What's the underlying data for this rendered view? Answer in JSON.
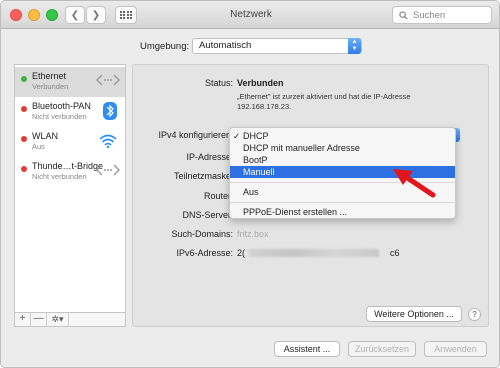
{
  "window": {
    "title": "Netzwerk"
  },
  "toolbar": {
    "search_placeholder": "Suchen"
  },
  "location": {
    "label": "Umgebung:",
    "value": "Automatisch"
  },
  "services": [
    {
      "name": "Ethernet",
      "status": "Verbunden",
      "color": "#3cb43c",
      "icon": "ethernet-icon"
    },
    {
      "name": "Bluetooth-PAN",
      "status": "Nicht verbunden",
      "color": "#e03b35",
      "icon": "bluetooth-icon"
    },
    {
      "name": "WLAN",
      "status": "Aus",
      "color": "#e03b35",
      "icon": "wifi-icon"
    },
    {
      "name": "Thunde…t-Bridge",
      "status": "Nicht verbunden",
      "color": "#e03b35",
      "icon": "ethernet-icon"
    }
  ],
  "sidebar_footer": {
    "add": "+",
    "remove": "—",
    "gear": "✲▾"
  },
  "detail": {
    "status_label": "Status:",
    "status_value": "Verbunden",
    "status_desc_1": "„Ethernet\" ist zurzeit aktiviert und hat die IP-Adresse",
    "status_desc_2": "192.168.178.23.",
    "ipv4_label": "IPv4 konfigurieren",
    "ip_label": "IP-Adresse",
    "subnet_label": "Teilnetzmaske",
    "router_label": "Router",
    "dns_label": "DNS-Server",
    "search_domains_label": "Such-Domains:",
    "search_domains_value": "fritz.box",
    "ipv6_label": "IPv6-Adresse:",
    "ipv6_prefix": "2(",
    "ipv6_suffix": "c6"
  },
  "dropdown": {
    "items": [
      {
        "label": "DHCP",
        "checked": "✓"
      },
      {
        "label": "DHCP mit manueller Adresse",
        "checked": ""
      },
      {
        "label": "BootP",
        "checked": ""
      },
      {
        "label": "Manuell",
        "checked": ""
      }
    ],
    "after_sep_1": "Aus",
    "after_sep_2": "PPPoE-Dienst erstellen ..."
  },
  "buttons": {
    "more_options": "Weitere Optionen ...",
    "help": "?",
    "assistant": "Assistent ...",
    "revert": "Zurücksetzen",
    "apply": "Anwenden"
  },
  "colors": {
    "accent": "#2f6fe4",
    "annotation_arrow": "#e3141b"
  }
}
